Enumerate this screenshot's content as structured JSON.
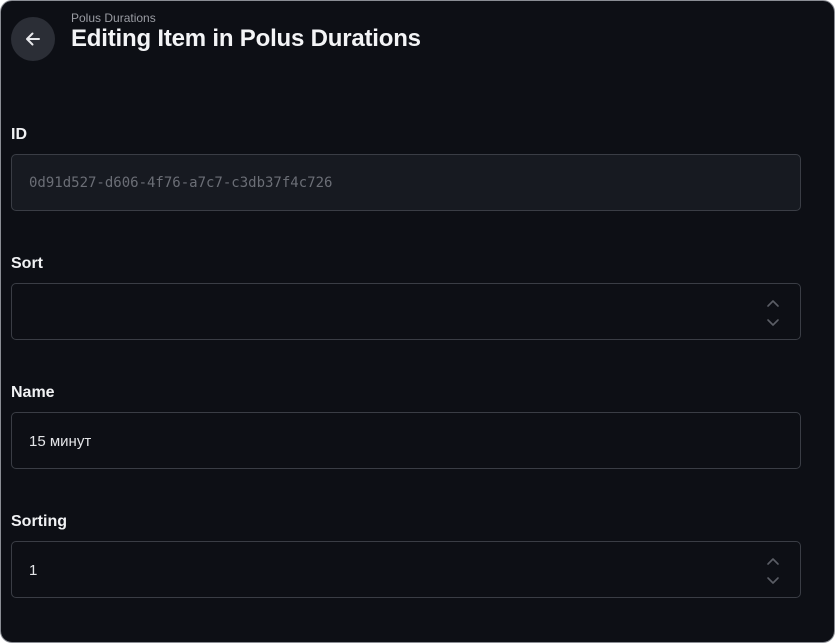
{
  "header": {
    "breadcrumb": "Polus Durations",
    "title": "Editing Item in Polus Durations",
    "back_icon": "arrow-left-icon"
  },
  "fields": {
    "id": {
      "label": "ID",
      "value": "0d91d527-d606-4f76-a7c7-c3db37f4c726",
      "readonly": true
    },
    "sort": {
      "label": "Sort",
      "value": ""
    },
    "name": {
      "label": "Name",
      "value": "15 минут"
    },
    "sorting": {
      "label": "Sorting",
      "value": "1"
    }
  },
  "colors": {
    "background": "#0d0f15",
    "input_border": "#3a3d45",
    "readonly_background": "#171a21",
    "text": "#f1f2f4",
    "muted": "#9a9ca3"
  },
  "icons": {
    "stepper": "chevron-up-down-icon"
  }
}
